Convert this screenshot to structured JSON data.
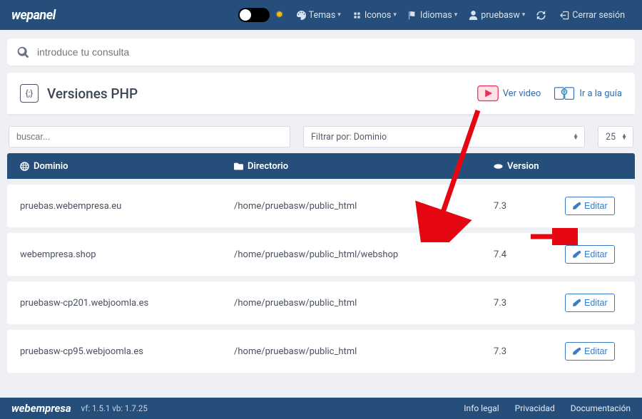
{
  "brand": "wepanel",
  "nav": {
    "themes": "Temas",
    "icons": "Iconos",
    "languages": "Idiomas",
    "user": "pruebasw",
    "logout": "Cerrar sesión"
  },
  "search": {
    "placeholder": "introduce tu consulta"
  },
  "page": {
    "title": "Versiones PHP",
    "video_label": "Ver video",
    "guide_label": "Ir a la guía"
  },
  "filters": {
    "search_placeholder": "buscar...",
    "domain_filter": "Filtrar por: Dominio",
    "page_size": "25"
  },
  "table": {
    "headers": {
      "domain": "Dominio",
      "dir": "Directorio",
      "version": "Version"
    },
    "edit_label": "Editar",
    "rows": [
      {
        "domain": "pruebas.webempresa.eu",
        "dir": "/home/pruebasw/public_html",
        "version": "7.3"
      },
      {
        "domain": "webempresa.shop",
        "dir": "/home/pruebasw/public_html/webshop",
        "version": "7.4"
      },
      {
        "domain": "pruebasw-cp201.webjoomla.es",
        "dir": "/home/pruebasw/public_html",
        "version": "7.3"
      },
      {
        "domain": "pruebasw-cp95.webjoomla.es",
        "dir": "/home/pruebasw/public_html",
        "version": "7.3"
      }
    ]
  },
  "footer": {
    "brand": "webempresa",
    "version": "vf: 1.5.1 vb: 1.7.25",
    "legal": "Info legal",
    "privacy": "Privacidad",
    "docs": "Documentación"
  }
}
